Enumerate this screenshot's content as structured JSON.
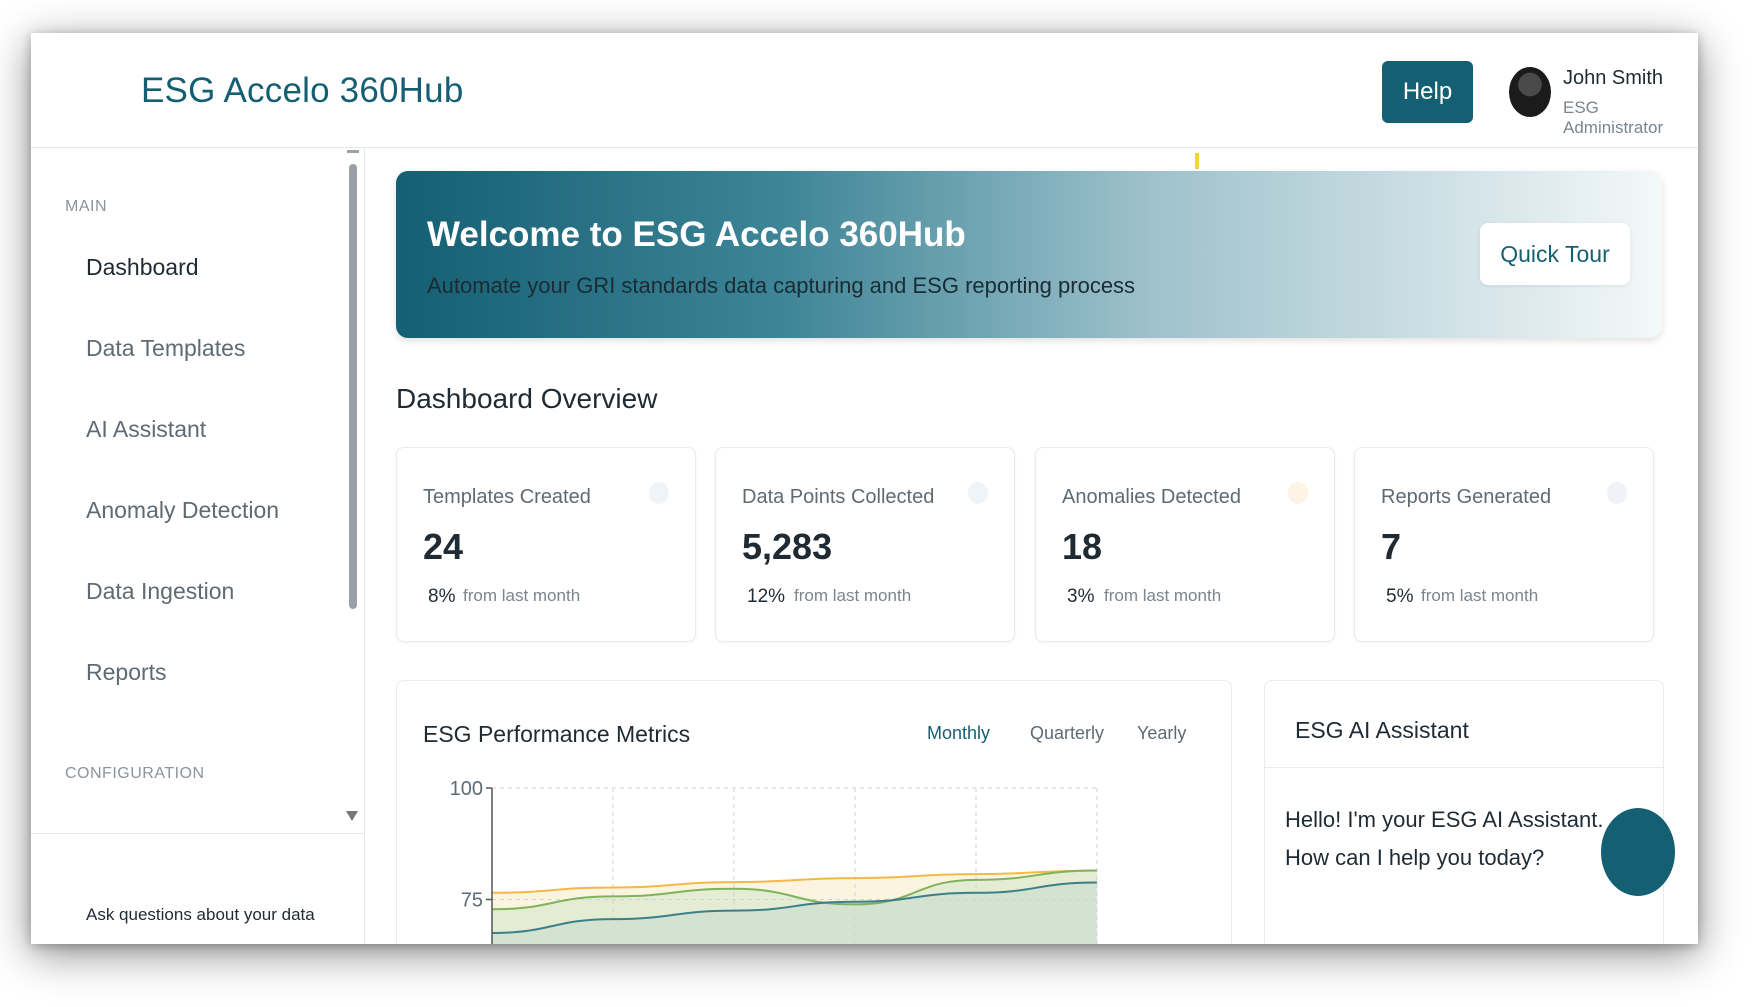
{
  "header": {
    "brand": "ESG Accelo 360Hub",
    "help_label": "Help",
    "user_name": "John Smith",
    "user_role": "ESG Administrator"
  },
  "sidebar": {
    "section_main": "MAIN",
    "items": [
      {
        "label": "Dashboard"
      },
      {
        "label": "Data Templates"
      },
      {
        "label": "AI Assistant"
      },
      {
        "label": "Anomaly Detection"
      },
      {
        "label": "Data Ingestion"
      },
      {
        "label": "Reports"
      }
    ],
    "section_config": "CONFIGURATION",
    "ask_text": "Ask questions about your data"
  },
  "welcome": {
    "title": "Welcome to ESG Accelo 360Hub",
    "subtitle": "Automate your GRI standards data capturing and ESG reporting process",
    "tour_label": "Quick Tour"
  },
  "overview": {
    "title": "Dashboard Overview",
    "cards": [
      {
        "label": "Templates Created",
        "value": "24",
        "change": "8%",
        "note": "from last month",
        "dot_color": "#eef4f8"
      },
      {
        "label": "Data Points Collected",
        "value": "5,283",
        "change": "12%",
        "note": "from last month",
        "dot_color": "#eef4f8"
      },
      {
        "label": "Anomalies Detected",
        "value": "18",
        "change": "3%",
        "note": "from last month",
        "dot_color": "#fdf4e6"
      },
      {
        "label": "Reports Generated",
        "value": "7",
        "change": "5%",
        "note": "from last month",
        "dot_color": "#f1f2f8"
      }
    ]
  },
  "performance": {
    "title": "ESG Performance Metrics",
    "tabs": [
      {
        "label": "Monthly",
        "active": true
      },
      {
        "label": "Quarterly",
        "active": false
      },
      {
        "label": "Yearly",
        "active": false
      }
    ]
  },
  "chart_data": {
    "type": "area",
    "x": [
      0,
      1,
      2,
      3,
      4,
      5
    ],
    "ylim": [
      50,
      100
    ],
    "yticks": [
      100,
      75
    ],
    "grid": true,
    "series": [
      {
        "values": [
          76.5,
          77.7,
          78.9,
          79.8,
          80.7,
          81.5
        ],
        "color": "#f2b94a",
        "fill": "#fbf3dc"
      },
      {
        "values": [
          72.8,
          75.7,
          77.4,
          73.9,
          79.4,
          81.5
        ],
        "color": "#7fb35e",
        "fill": "#e3ecd2"
      },
      {
        "values": [
          67.5,
          70.6,
          72.5,
          74.5,
          76.5,
          78.8
        ],
        "color": "#3c7f8a",
        "fill": "#d3e2d0"
      }
    ]
  },
  "ai_assistant": {
    "title": "ESG AI Assistant",
    "message": "Hello! I'm your ESG AI Assistant. How can I help you today?"
  }
}
